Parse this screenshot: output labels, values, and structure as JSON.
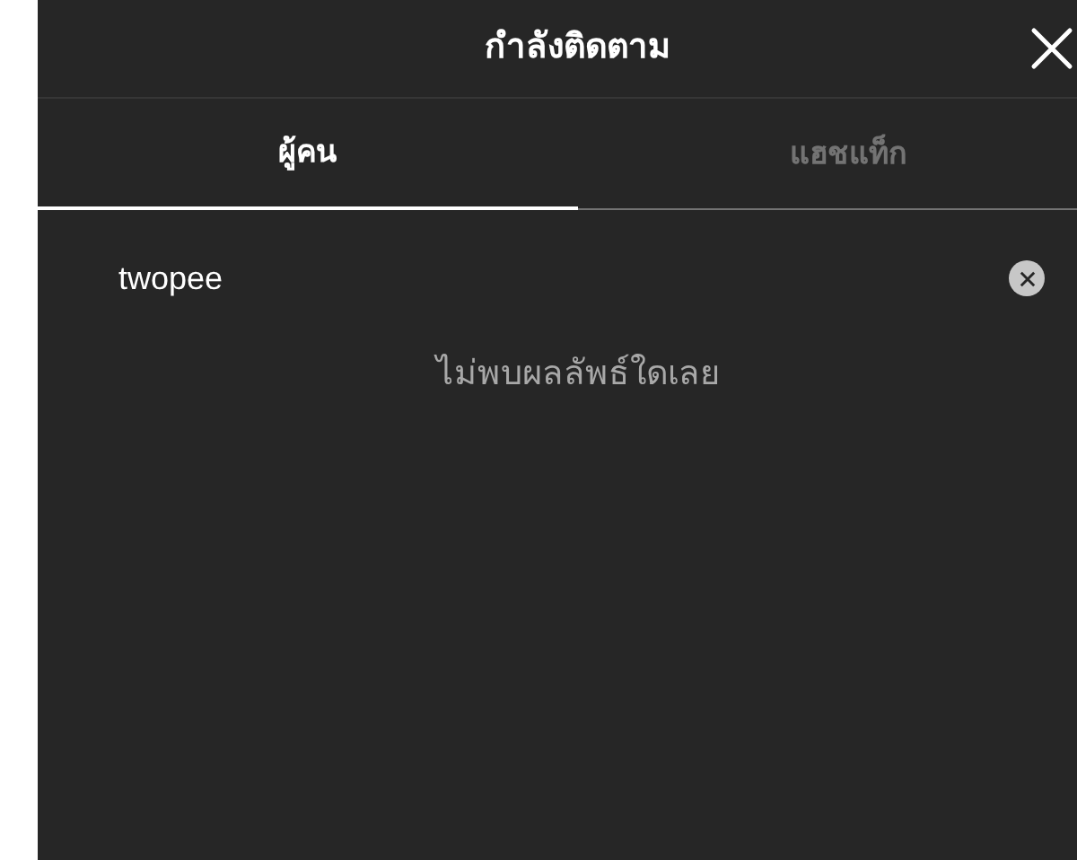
{
  "header": {
    "title": "กำลังติดตาม"
  },
  "tabs": [
    {
      "label": "ผู้คน",
      "selected": true
    },
    {
      "label": "แฮชแท็ก",
      "selected": false
    }
  ],
  "search": {
    "value": "twopee"
  },
  "message": "ไม่พบผลลัพธ์ใดเลย"
}
